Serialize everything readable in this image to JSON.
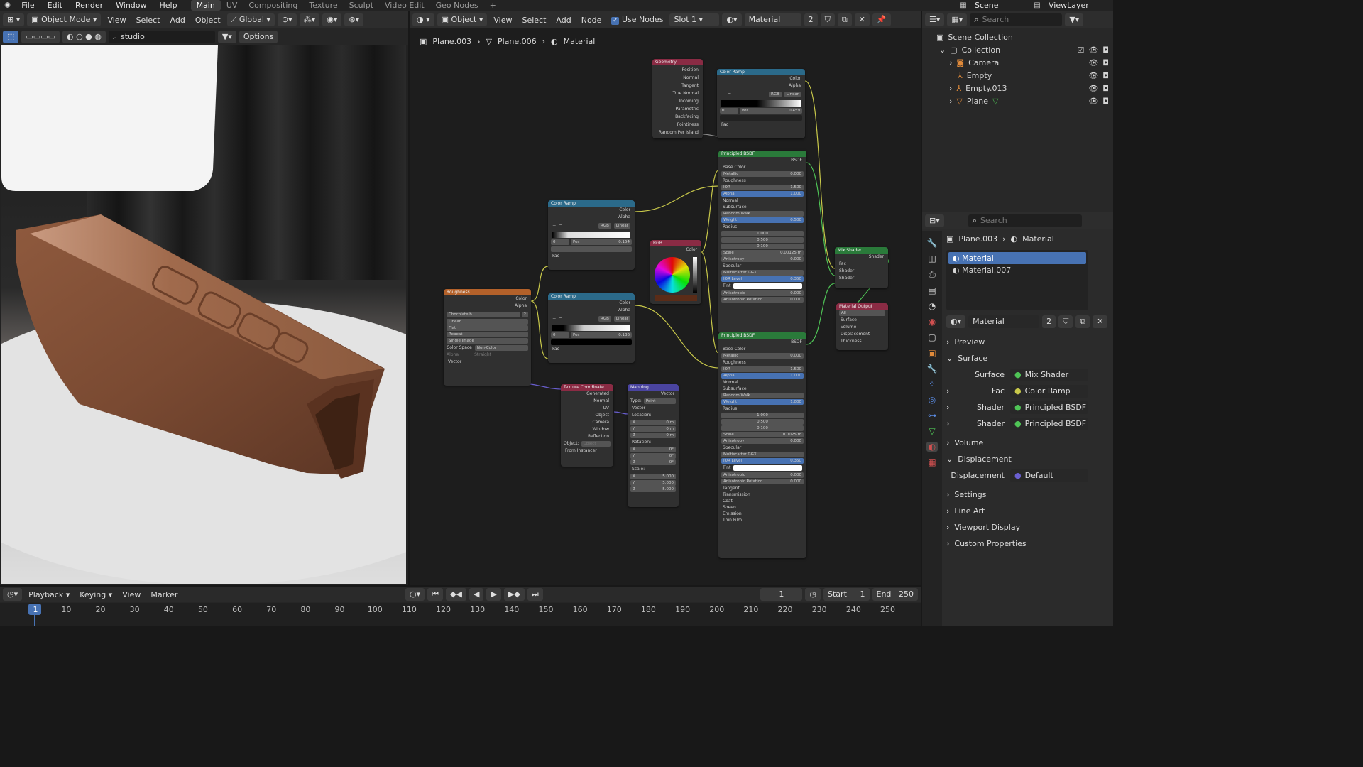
{
  "topbar": {
    "menus": [
      "File",
      "Edit",
      "Render",
      "Window",
      "Help"
    ],
    "workspaces": [
      "Main",
      "UV",
      "Compositing",
      "Texture",
      "Sculpt",
      "Video Edit",
      "Geo Nodes"
    ],
    "active_workspace": "Main",
    "add_tab": "+",
    "scene": "Scene",
    "view_layer": "ViewLayer"
  },
  "viewport": {
    "mode": "Object Mode",
    "menus": [
      "View",
      "Select",
      "Add",
      "Object"
    ],
    "transform": "Global",
    "search_value": "studio",
    "options": "Options"
  },
  "node_editor": {
    "type": "Object",
    "menus": [
      "View",
      "Select",
      "Add",
      "Node"
    ],
    "use_nodes": "Use Nodes",
    "slot": "Slot 1",
    "material": "Material",
    "users": "2",
    "breadcrumb": [
      "Plane.003",
      "Plane.006",
      "Material"
    ]
  },
  "nodes": {
    "geometry": {
      "title": "Geometry",
      "outputs": [
        "Position",
        "Normal",
        "Tangent",
        "True Normal",
        "Incoming",
        "Parametric",
        "Backfacing",
        "Pointiness",
        "Random Per Island"
      ]
    },
    "color_ramp_top": {
      "title": "Color Ramp",
      "outputs": [
        "Color",
        "Alpha"
      ],
      "mode": "RGB",
      "interp": "Linear",
      "index": "0",
      "pos_label": "Pos",
      "pos": "0.459",
      "input": "Fac"
    },
    "color_ramp_mid": {
      "title": "Color Ramp",
      "outputs": [
        "Color",
        "Alpha"
      ],
      "mode": "RGB",
      "interp": "Linear",
      "index": "0",
      "pos_label": "Pos",
      "pos": "0.154",
      "input": "Fac"
    },
    "color_ramp_low": {
      "title": "Color Ramp",
      "outputs": [
        "Color",
        "Alpha"
      ],
      "mode": "RGB",
      "interp": "Linear",
      "index": "0",
      "pos_label": "Pos",
      "pos": "0.136",
      "input": "Fac"
    },
    "rgb": {
      "title": "RGB",
      "output": "Color"
    },
    "roughness": {
      "title": "Roughness",
      "outputs": [
        "Color",
        "Alpha"
      ],
      "image": "Chocolate b...",
      "users": "2",
      "interp": "Linear",
      "proj": "Flat",
      "ext": "Repeat",
      "source": "Single Image",
      "cs_label": "Color Space",
      "cs": "Non-Color",
      "alpha_label": "Alpha",
      "alpha": "Straight",
      "input": "Vector"
    },
    "bsdf1": {
      "title": "Principled BSDF",
      "output": "BSDF",
      "rows": [
        [
          "Base Color",
          ""
        ],
        [
          "Metallic",
          "0.000"
        ],
        [
          "Roughness",
          ""
        ],
        [
          "IOR",
          "1.500"
        ],
        [
          "Alpha",
          "1.000"
        ],
        [
          "Normal",
          ""
        ],
        [
          "Subsurface",
          ""
        ],
        [
          "Random Walk",
          ""
        ],
        [
          "Weight",
          "0.500"
        ],
        [
          "Radius",
          ""
        ],
        [
          "",
          "1.000"
        ],
        [
          "",
          "0.500"
        ],
        [
          "",
          "0.100"
        ],
        [
          "Scale",
          "0.00125 m"
        ],
        [
          "Anisotropy",
          "0.000"
        ],
        [
          "Specular",
          ""
        ],
        [
          "Multiscatter GGX",
          ""
        ],
        [
          "IOR Level",
          "0.350"
        ],
        [
          "Tint",
          ""
        ],
        [
          "Anisotropic",
          "0.000"
        ],
        [
          "Anisotropic Rotation",
          "0.000"
        ]
      ]
    },
    "bsdf2": {
      "title": "Principled BSDF",
      "output": "BSDF",
      "rows": [
        [
          "Base Color",
          ""
        ],
        [
          "Metallic",
          "0.000"
        ],
        [
          "Roughness",
          ""
        ],
        [
          "IOR",
          "1.500"
        ],
        [
          "Alpha",
          "1.000"
        ],
        [
          "Normal",
          ""
        ],
        [
          "Subsurface",
          ""
        ],
        [
          "Random Walk",
          ""
        ],
        [
          "Weight",
          "1.000"
        ],
        [
          "Radius",
          ""
        ],
        [
          "",
          "1.000"
        ],
        [
          "",
          "0.500"
        ],
        [
          "",
          "0.100"
        ],
        [
          "Scale",
          "0.0025 m"
        ],
        [
          "Anisotropy",
          "0.000"
        ],
        [
          "Specular",
          ""
        ],
        [
          "Multiscatter GGX",
          ""
        ],
        [
          "IOR Level",
          "0.350"
        ],
        [
          "Tint",
          ""
        ],
        [
          "Anisotropic",
          "0.000"
        ],
        [
          "Anisotropic Rotation",
          "0.000"
        ],
        [
          "Tangent",
          ""
        ],
        [
          "Transmission",
          ""
        ],
        [
          "Coat",
          ""
        ],
        [
          "Sheen",
          ""
        ],
        [
          "Emission",
          ""
        ],
        [
          "Thin Film",
          ""
        ]
      ]
    },
    "mix": {
      "title": "Mix Shader",
      "output": "Shader",
      "inputs": [
        "Fac",
        "Shader",
        "Shader"
      ]
    },
    "output": {
      "title": "Material Output",
      "target": "All",
      "inputs": [
        "Surface",
        "Volume",
        "Displacement",
        "Thickness"
      ]
    },
    "texcoord": {
      "title": "Texture Coordinate",
      "outputs": [
        "Generated",
        "Normal",
        "UV",
        "Object",
        "Camera",
        "Window",
        "Reflection"
      ],
      "object_label": "Object:",
      "object": "Object",
      "from_instancer": "From Instancer"
    },
    "mapping": {
      "title": "Mapping",
      "output": "Vector",
      "type_label": "Type:",
      "type": "Point",
      "vector": "Vector",
      "loc_label": "Location:",
      "loc": [
        "0 m",
        "0 m",
        "0 m"
      ],
      "rot_label": "Rotation:",
      "rot": [
        "0°",
        "0°",
        "0°"
      ],
      "scale_label": "Scale:",
      "scale": [
        "5.000",
        "5.000",
        "5.000"
      ],
      "axes": [
        "X",
        "Y",
        "Z"
      ]
    }
  },
  "outliner": {
    "search": "Search",
    "root": "Scene Collection",
    "items": [
      {
        "label": "Collection"
      },
      {
        "label": "Camera"
      },
      {
        "label": "Empty"
      },
      {
        "label": "Empty.013"
      },
      {
        "label": "Plane"
      }
    ]
  },
  "properties": {
    "search": "Search",
    "breadcrumb": [
      "Plane.003",
      "Material"
    ],
    "slots": [
      "Material",
      "Material.007"
    ],
    "material": "Material",
    "users": "2",
    "sections": {
      "preview": "Preview",
      "surface": "Surface",
      "volume": "Volume",
      "displacement": "Displacement",
      "settings": "Settings",
      "line_art": "Line Art",
      "viewport_display": "Viewport Display",
      "custom_properties": "Custom Properties"
    },
    "surface_rows": [
      [
        "Surface",
        "Mix Shader"
      ],
      [
        "Fac",
        "Color Ramp"
      ],
      [
        "Shader",
        "Principled BSDF"
      ],
      [
        "Shader",
        "Principled BSDF"
      ]
    ],
    "displacement_row": [
      "Displacement",
      "Default"
    ]
  },
  "timeline": {
    "menus": [
      "Playback",
      "Keying",
      "View",
      "Marker"
    ],
    "frame": "1",
    "start_label": "Start",
    "start": "1",
    "end_label": "End",
    "end": "250",
    "ticks": [
      "1",
      "10",
      "20",
      "30",
      "40",
      "50",
      "60",
      "70",
      "80",
      "90",
      "100",
      "110",
      "120",
      "130",
      "140",
      "150",
      "160",
      "170",
      "180",
      "190",
      "200",
      "210",
      "220",
      "230",
      "240",
      "250"
    ]
  },
  "colors": {
    "accent": "#4772b3",
    "shader_header": "#2a7a3a",
    "color_header": "#2b6a8a",
    "input_header": "#8a2b44",
    "texture_header": "#b3612a",
    "vector_header": "#4a44a0"
  }
}
